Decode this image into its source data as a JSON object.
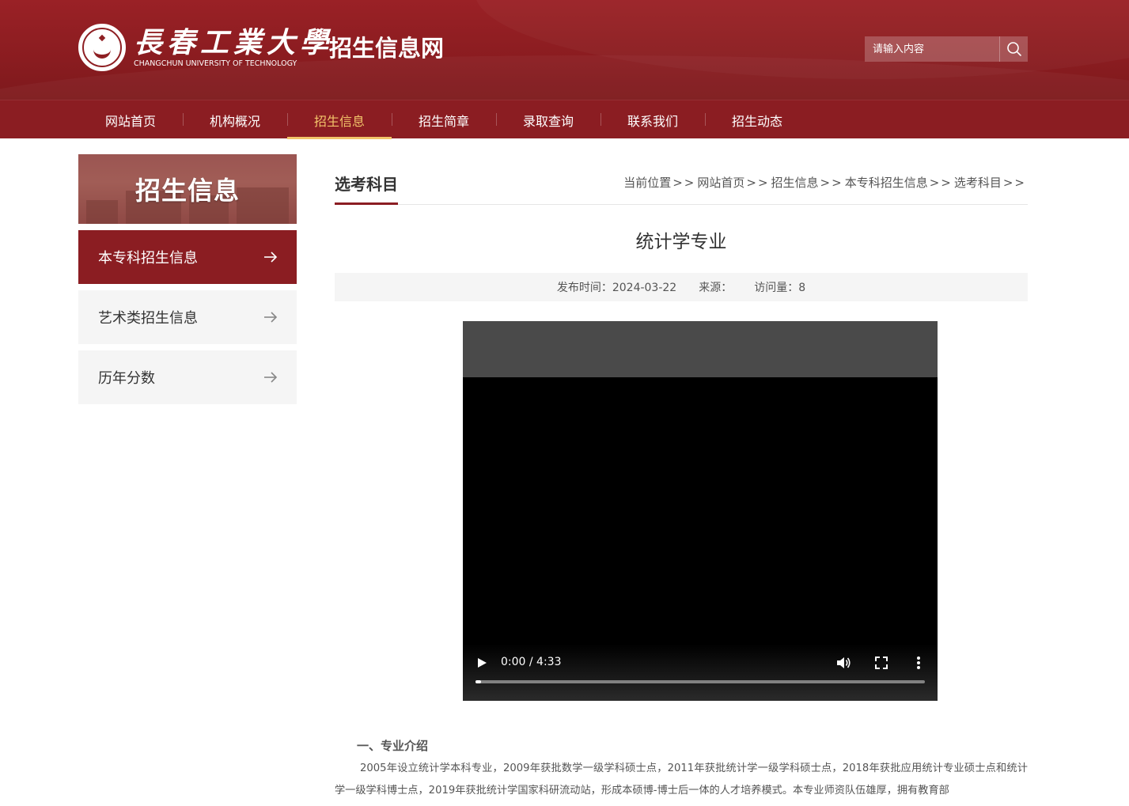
{
  "header": {
    "logo_cn": "長春工業大學",
    "logo_en": "CHANGCHUN UNIVERSITY OF TECHNOLOGY",
    "site_title": "招生信息网",
    "search_placeholder": "请输入内容",
    "search_icon": "search-icon"
  },
  "nav": {
    "items": [
      {
        "label": "网站首页",
        "active": false
      },
      {
        "label": "机构概况",
        "active": false
      },
      {
        "label": "招生信息",
        "active": true
      },
      {
        "label": "招生简章",
        "active": false
      },
      {
        "label": "录取查询",
        "active": false
      },
      {
        "label": "联系我们",
        "active": false
      },
      {
        "label": "招生动态",
        "active": false
      }
    ],
    "active_color": "#f2c46a"
  },
  "sidebar": {
    "banner_title": "招生信息",
    "items": [
      {
        "label": "本专科招生信息",
        "active": true
      },
      {
        "label": "艺术类招生信息",
        "active": false
      },
      {
        "label": "历年分数",
        "active": false
      }
    ],
    "arrow_icon": "arrow-right-icon"
  },
  "main": {
    "section_title": "选考科目",
    "breadcrumb": {
      "prefix": "当前位置",
      "items": [
        "网站首页",
        "招生信息",
        "本专科招生信息",
        "选考科目"
      ],
      "separator": ">>"
    },
    "article_title": "统计学专业",
    "meta": {
      "date_label": "发布时间：2024-03-22",
      "source_label": "来源：",
      "views_label": "访问量：8"
    },
    "video": {
      "time": "0:00 / 4:33",
      "progress": 0.01
    },
    "body": {
      "heading": "一、专业介绍",
      "paragraph": "2005年设立统计学本科专业，2009年获批数学一级学科硕士点，2011年获批统计学一级学科硕士点，2018年获批应用统计专业硕士点和统计学一级学科博士点，2019年获批统计学国家科研流动站，形成本硕博-博士后一体的人才培养模式。本专业师资队伍雄厚，拥有教育部"
    }
  },
  "colors": {
    "brand": "#8b1d22",
    "header_bg": "#9a2126",
    "accent": "#f2c46a",
    "sidebar_bg": "#f5f5f5"
  }
}
